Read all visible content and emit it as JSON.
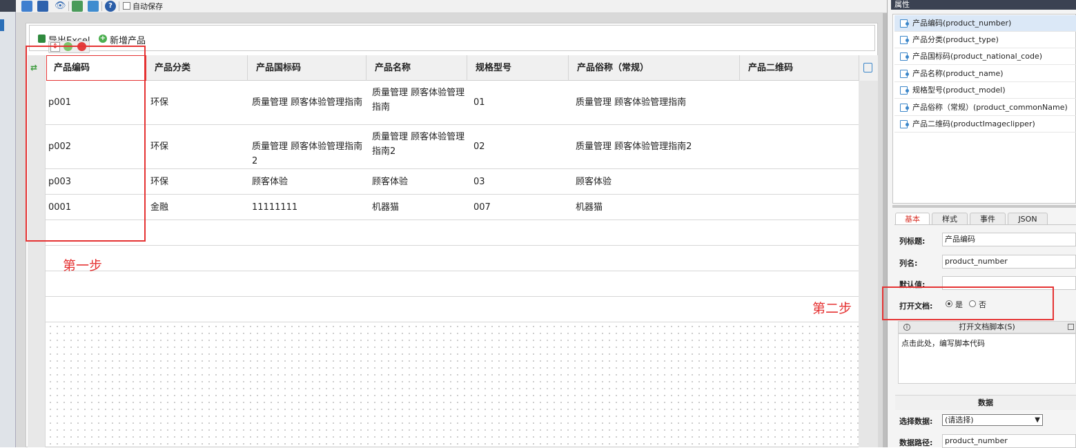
{
  "toolbar": {
    "autosave_label": "自动保存"
  },
  "grid_toolbar": {
    "export_label": "导出Excel",
    "add_label": "新增产品"
  },
  "table": {
    "columns": [
      "产品编码",
      "产品分类",
      "产品国标码",
      "产品名称",
      "规格型号",
      "产品俗称（常规）",
      "产品二维码"
    ],
    "rows": [
      [
        "p001",
        "环保",
        "质量管理 顾客体验管理指南",
        "质量管理 顾客体验管理指南",
        "01",
        "质量管理 顾客体验管理指南",
        ""
      ],
      [
        "p002",
        "环保",
        "质量管理 顾客体验管理指南2",
        "质量管理 顾客体验管理指南2",
        "02",
        "质量管理 顾客体验管理指南2",
        ""
      ],
      [
        "p003",
        "环保",
        "顾客体验",
        "顾客体验",
        "03",
        "顾客体验",
        ""
      ],
      [
        "0001",
        "金融",
        "11111111",
        "机器猫",
        "007",
        "机器猫",
        ""
      ]
    ]
  },
  "annotations": {
    "step1": "第一步",
    "step2": "第二步"
  },
  "panel": {
    "title": "属性",
    "fields": [
      "产品编码(product_number)",
      "产品分类(product_type)",
      "产品国标码(product_national_code)",
      "产品名称(product_name)",
      "规格型号(product_model)",
      "产品俗称（常规）(product_commonName)",
      "产品二维码(productImageclipper)"
    ],
    "tabs": [
      "基本",
      "样式",
      "事件",
      "JSON"
    ],
    "col_title_label": "列标题:",
    "col_title_value": "产品编码",
    "col_name_label": "列名:",
    "col_name_value": "product_number",
    "default_label": "默认值:",
    "open_doc_label": "打开文档:",
    "yes": "是",
    "no": "否",
    "script_header": "打开文档脚本(S)",
    "script_placeholder": "点击此处，编写脚本代码",
    "data_section": "数据",
    "select_data_label": "选择数据:",
    "select_data_value": "(请选择)",
    "data_path_label": "数据路径:",
    "data_path_value": "product_number"
  },
  "colors": {
    "accent_red": "#e53232",
    "selection": "#dbe8f7",
    "dark_header": "#3b4252"
  }
}
